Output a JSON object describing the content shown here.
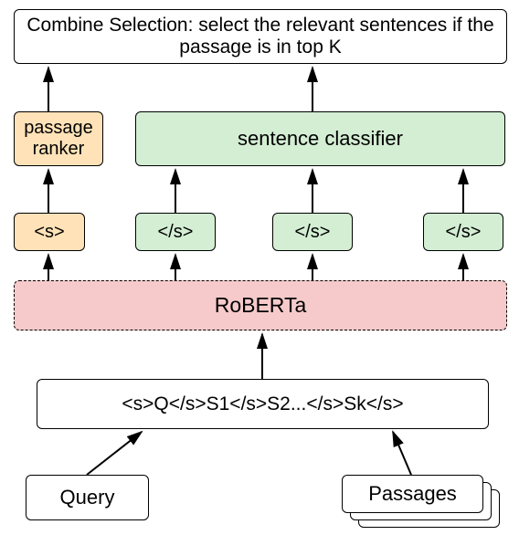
{
  "top_box": "Combine Selection: select the relevant sentences if the passage is in top K",
  "passage_ranker": "passage ranker",
  "sentence_classifier": "sentence classifier",
  "token_s": "<s>",
  "token_cs1": "</s>",
  "token_cs2": "</s>",
  "token_cs3": "</s>",
  "roberta": "RoBERTa",
  "input_seq": "<s>Q</s>S1</s>S2...</s>Sk</s>",
  "query": "Query",
  "passages": "Passages",
  "chart_data": {
    "type": "diagram",
    "nodes": [
      {
        "id": "query",
        "label": "Query"
      },
      {
        "id": "passages",
        "label": "Passages"
      },
      {
        "id": "input_seq",
        "label": "<s>Q</s>S1</s>S2...</s>Sk</s>"
      },
      {
        "id": "roberta",
        "label": "RoBERTa"
      },
      {
        "id": "tok_s",
        "label": "<s>"
      },
      {
        "id": "tok_cs1",
        "label": "</s>"
      },
      {
        "id": "tok_cs2",
        "label": "</s>"
      },
      {
        "id": "tok_cs3",
        "label": "</s>"
      },
      {
        "id": "passage_ranker",
        "label": "passage ranker"
      },
      {
        "id": "sentence_classifier",
        "label": "sentence classifier"
      },
      {
        "id": "combine",
        "label": "Combine Selection: select the relevant sentences if the passage is in top K"
      }
    ],
    "edges": [
      {
        "from": "query",
        "to": "input_seq"
      },
      {
        "from": "passages",
        "to": "input_seq"
      },
      {
        "from": "input_seq",
        "to": "roberta"
      },
      {
        "from": "roberta",
        "to": "tok_s"
      },
      {
        "from": "roberta",
        "to": "tok_cs1"
      },
      {
        "from": "roberta",
        "to": "tok_cs2"
      },
      {
        "from": "roberta",
        "to": "tok_cs3"
      },
      {
        "from": "tok_s",
        "to": "passage_ranker"
      },
      {
        "from": "tok_cs1",
        "to": "sentence_classifier"
      },
      {
        "from": "tok_cs2",
        "to": "sentence_classifier"
      },
      {
        "from": "tok_cs3",
        "to": "sentence_classifier"
      },
      {
        "from": "passage_ranker",
        "to": "combine"
      },
      {
        "from": "sentence_classifier",
        "to": "combine"
      }
    ]
  }
}
